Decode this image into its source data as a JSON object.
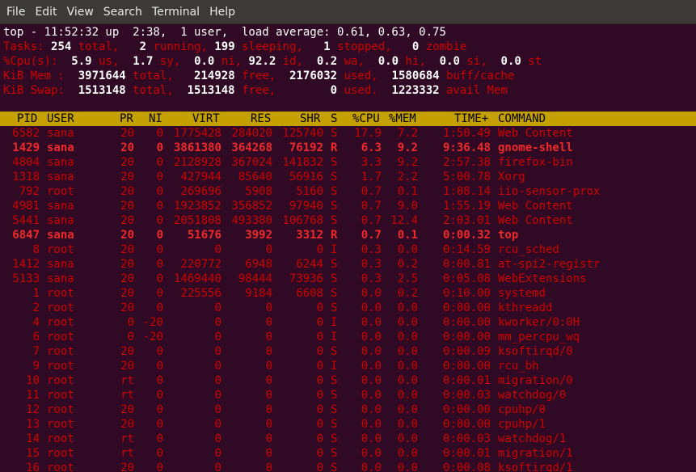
{
  "menubar": {
    "items": [
      "File",
      "Edit",
      "View",
      "Search",
      "Terminal",
      "Help"
    ]
  },
  "summary": {
    "line1": "top - 11:52:32 up  2:38,  1 user,  load average: 0.61, 0.63, 0.75",
    "tasks": {
      "label": "Tasks:",
      "total": "254",
      "total_label": "total,",
      "running": "2",
      "running_label": "running,",
      "sleeping": "199",
      "sleeping_label": "sleeping,",
      "stopped": "1",
      "stopped_label": "stopped,",
      "zombie": "0",
      "zombie_label": "zombie"
    },
    "cpu": {
      "label": "%Cpu(s):",
      "us": "5.9",
      "us_label": "us,",
      "sy": "1.7",
      "sy_label": "sy,",
      "ni": "0.0",
      "ni_label": "ni,",
      "id": "92.2",
      "id_label": "id,",
      "wa": "0.2",
      "wa_label": "wa,",
      "hi": "0.0",
      "hi_label": "hi,",
      "si": "0.0",
      "si_label": "si,",
      "st": "0.0",
      "st_label": "st"
    },
    "mem": {
      "label": "KiB Mem :",
      "total": "3971644",
      "total_label": "total,",
      "free": "214928",
      "free_label": "free,",
      "used": "2176032",
      "used_label": "used,",
      "buff": "1580684",
      "buff_label": "buff/cache"
    },
    "swap": {
      "label": "KiB Swap:",
      "total": "1513148",
      "total_label": "total,",
      "free": "1513148",
      "free_label": "free,",
      "used": "0",
      "used_label": "used.",
      "avail": "1223332",
      "avail_label": "avail Mem"
    }
  },
  "table": {
    "headers": [
      "PID",
      "USER",
      "PR",
      "NI",
      "VIRT",
      "RES",
      "SHR",
      "S",
      "%CPU",
      "%MEM",
      "TIME+",
      "COMMAND"
    ],
    "rows": [
      {
        "pid": "6582",
        "user": "sana",
        "pr": "20",
        "ni": "0",
        "virt": "1775428",
        "res": "284020",
        "shr": "125740",
        "s": "S",
        "cpu": "17.9",
        "mem": "7.2",
        "time": "1:50.49",
        "cmd": "Web Content",
        "bold": false
      },
      {
        "pid": "1429",
        "user": "sana",
        "pr": "20",
        "ni": "0",
        "virt": "3861380",
        "res": "364268",
        "shr": "76192",
        "s": "R",
        "cpu": "6.3",
        "mem": "9.2",
        "time": "9:36.48",
        "cmd": "gnome-shell",
        "bold": true
      },
      {
        "pid": "4804",
        "user": "sana",
        "pr": "20",
        "ni": "0",
        "virt": "2128928",
        "res": "367024",
        "shr": "141832",
        "s": "S",
        "cpu": "3.3",
        "mem": "9.2",
        "time": "2:57.38",
        "cmd": "firefox-bin",
        "bold": false
      },
      {
        "pid": "1318",
        "user": "sana",
        "pr": "20",
        "ni": "0",
        "virt": "427944",
        "res": "85640",
        "shr": "56916",
        "s": "S",
        "cpu": "1.7",
        "mem": "2.2",
        "time": "5:00.78",
        "cmd": "Xorg",
        "bold": false
      },
      {
        "pid": "792",
        "user": "root",
        "pr": "20",
        "ni": "0",
        "virt": "269696",
        "res": "5908",
        "shr": "5160",
        "s": "S",
        "cpu": "0.7",
        "mem": "0.1",
        "time": "1:08.14",
        "cmd": "iio-sensor-prox",
        "bold": false
      },
      {
        "pid": "4981",
        "user": "sana",
        "pr": "20",
        "ni": "0",
        "virt": "1923852",
        "res": "356852",
        "shr": "97940",
        "s": "S",
        "cpu": "0.7",
        "mem": "9.0",
        "time": "1:55.19",
        "cmd": "Web Content",
        "bold": false
      },
      {
        "pid": "5441",
        "user": "sana",
        "pr": "20",
        "ni": "0",
        "virt": "2051808",
        "res": "493380",
        "shr": "106768",
        "s": "S",
        "cpu": "0.7",
        "mem": "12.4",
        "time": "2:03.01",
        "cmd": "Web Content",
        "bold": false
      },
      {
        "pid": "6847",
        "user": "sana",
        "pr": "20",
        "ni": "0",
        "virt": "51676",
        "res": "3992",
        "shr": "3312",
        "s": "R",
        "cpu": "0.7",
        "mem": "0.1",
        "time": "0:00.32",
        "cmd": "top",
        "bold": true
      },
      {
        "pid": "8",
        "user": "root",
        "pr": "20",
        "ni": "0",
        "virt": "0",
        "res": "0",
        "shr": "0",
        "s": "I",
        "cpu": "0.3",
        "mem": "0.0",
        "time": "0:14.59",
        "cmd": "rcu_sched",
        "bold": false
      },
      {
        "pid": "1412",
        "user": "sana",
        "pr": "20",
        "ni": "0",
        "virt": "220772",
        "res": "6948",
        "shr": "6244",
        "s": "S",
        "cpu": "0.3",
        "mem": "0.2",
        "time": "0:00.81",
        "cmd": "at-spi2-registr",
        "bold": false
      },
      {
        "pid": "5133",
        "user": "sana",
        "pr": "20",
        "ni": "0",
        "virt": "1469440",
        "res": "98444",
        "shr": "73936",
        "s": "S",
        "cpu": "0.3",
        "mem": "2.5",
        "time": "0:05.08",
        "cmd": "WebExtensions",
        "bold": false
      },
      {
        "pid": "1",
        "user": "root",
        "pr": "20",
        "ni": "0",
        "virt": "225556",
        "res": "9184",
        "shr": "6608",
        "s": "S",
        "cpu": "0.0",
        "mem": "0.2",
        "time": "0:10.00",
        "cmd": "systemd",
        "bold": false
      },
      {
        "pid": "2",
        "user": "root",
        "pr": "20",
        "ni": "0",
        "virt": "0",
        "res": "0",
        "shr": "0",
        "s": "S",
        "cpu": "0.0",
        "mem": "0.0",
        "time": "0:00.00",
        "cmd": "kthreadd",
        "bold": false
      },
      {
        "pid": "4",
        "user": "root",
        "pr": "0",
        "ni": "-20",
        "virt": "0",
        "res": "0",
        "shr": "0",
        "s": "I",
        "cpu": "0.0",
        "mem": "0.0",
        "time": "0:00.00",
        "cmd": "kworker/0:0H",
        "bold": false
      },
      {
        "pid": "6",
        "user": "root",
        "pr": "0",
        "ni": "-20",
        "virt": "0",
        "res": "0",
        "shr": "0",
        "s": "I",
        "cpu": "0.0",
        "mem": "0.0",
        "time": "0:00.00",
        "cmd": "mm_percpu_wq",
        "bold": false
      },
      {
        "pid": "7",
        "user": "root",
        "pr": "20",
        "ni": "0",
        "virt": "0",
        "res": "0",
        "shr": "0",
        "s": "S",
        "cpu": "0.0",
        "mem": "0.0",
        "time": "0:00.09",
        "cmd": "ksoftirqd/0",
        "bold": false
      },
      {
        "pid": "9",
        "user": "root",
        "pr": "20",
        "ni": "0",
        "virt": "0",
        "res": "0",
        "shr": "0",
        "s": "I",
        "cpu": "0.0",
        "mem": "0.0",
        "time": "0:00.00",
        "cmd": "rcu_bh",
        "bold": false
      },
      {
        "pid": "10",
        "user": "root",
        "pr": "rt",
        "ni": "0",
        "virt": "0",
        "res": "0",
        "shr": "0",
        "s": "S",
        "cpu": "0.0",
        "mem": "0.0",
        "time": "0:00.01",
        "cmd": "migration/0",
        "bold": false
      },
      {
        "pid": "11",
        "user": "root",
        "pr": "rt",
        "ni": "0",
        "virt": "0",
        "res": "0",
        "shr": "0",
        "s": "S",
        "cpu": "0.0",
        "mem": "0.0",
        "time": "0:00.03",
        "cmd": "watchdog/0",
        "bold": false
      },
      {
        "pid": "12",
        "user": "root",
        "pr": "20",
        "ni": "0",
        "virt": "0",
        "res": "0",
        "shr": "0",
        "s": "S",
        "cpu": "0.0",
        "mem": "0.0",
        "time": "0:00.00",
        "cmd": "cpuhp/0",
        "bold": false
      },
      {
        "pid": "13",
        "user": "root",
        "pr": "20",
        "ni": "0",
        "virt": "0",
        "res": "0",
        "shr": "0",
        "s": "S",
        "cpu": "0.0",
        "mem": "0.0",
        "time": "0:00.00",
        "cmd": "cpuhp/1",
        "bold": false
      },
      {
        "pid": "14",
        "user": "root",
        "pr": "rt",
        "ni": "0",
        "virt": "0",
        "res": "0",
        "shr": "0",
        "s": "S",
        "cpu": "0.0",
        "mem": "0.0",
        "time": "0:00.03",
        "cmd": "watchdog/1",
        "bold": false
      },
      {
        "pid": "15",
        "user": "root",
        "pr": "rt",
        "ni": "0",
        "virt": "0",
        "res": "0",
        "shr": "0",
        "s": "S",
        "cpu": "0.0",
        "mem": "0.0",
        "time": "0:00.01",
        "cmd": "migration/1",
        "bold": false
      },
      {
        "pid": "16",
        "user": "root",
        "pr": "20",
        "ni": "0",
        "virt": "0",
        "res": "0",
        "shr": "0",
        "s": "S",
        "cpu": "0.0",
        "mem": "0.0",
        "time": "0:00.08",
        "cmd": "ksoftirqd/1",
        "bold": false
      }
    ]
  },
  "colors": {
    "background": "#300a24",
    "text_red": "#cc0000",
    "header_bar": "#c4a000",
    "menubar": "#3b3a36"
  }
}
